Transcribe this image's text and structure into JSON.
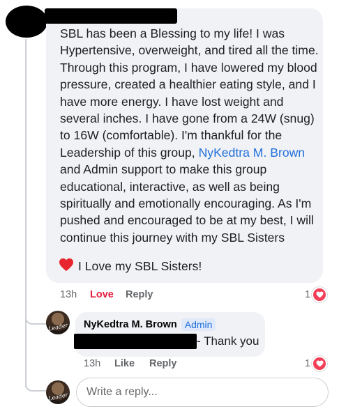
{
  "comment": {
    "text_before_mention": "SBL has been a Blessing to my life! I was Hypertensive, overweight, and tired all the time. Through this program, I have lowered my blood pressure, created a healthier eating style, and I have more energy. I have lost weight and several inches. I have gone from a 24W (snug) to 16W (comfortable). I'm thankful for the Leadership of this group, ",
    "mention": "NyKedtra M. Brown",
    "text_after_mention": "  and Admin support to make this group educational, interactive, as well as being spiritually and emotionally encouraging. As I'm pushed and encouraged to be at my best, I will continue this journey with my SBL Sisters",
    "heart_line": "I Love my SBL Sisters!",
    "time": "13h",
    "love_label": "Love",
    "reply_label": "Reply",
    "reaction_count": "1"
  },
  "reply": {
    "author": "NyKedtra M. Brown",
    "badge": "Admin",
    "text": "- Thank you",
    "time": "13h",
    "like_label": "Like",
    "reply_label": "Reply",
    "reaction_count": "1",
    "avatar_signature": "Leader"
  },
  "composer": {
    "placeholder": "Write a reply...",
    "avatar_signature": "Leader"
  },
  "colors": {
    "bubble": "#f0f2f5",
    "link": "#216fdb",
    "love": "#e41e3f",
    "reaction": "#f33e58"
  }
}
